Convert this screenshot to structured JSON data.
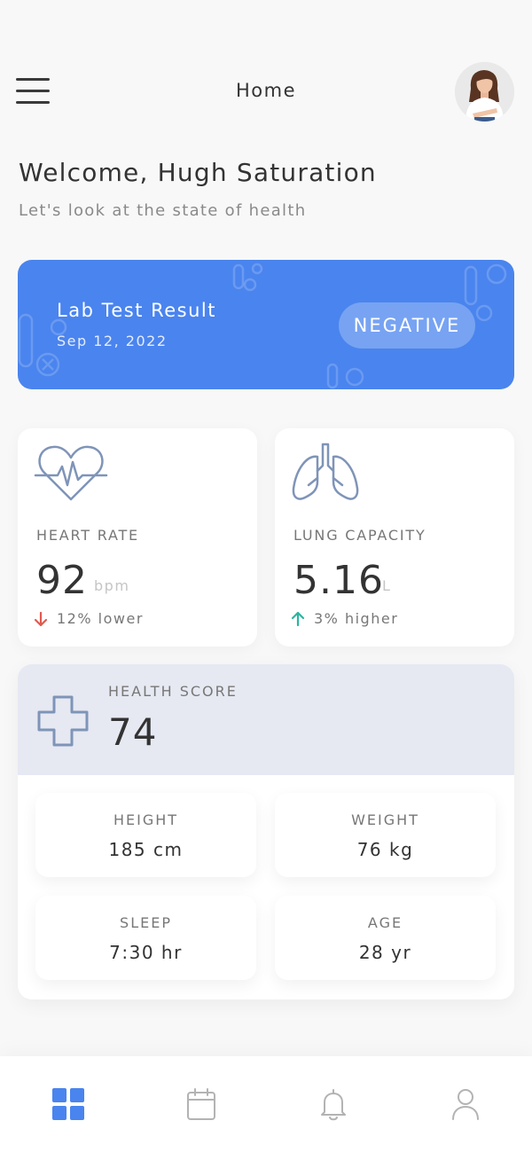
{
  "header": {
    "title": "Home"
  },
  "greeting": {
    "title": "Welcome, Hugh Saturation",
    "subtitle": "Let's look at the state of health"
  },
  "lab": {
    "title": "Lab Test Result",
    "date": "Sep 12, 2022",
    "status": "NEGATIVE"
  },
  "metrics": [
    {
      "label": "HEART RATE",
      "value": "92",
      "unit": "bpm",
      "change": "12% lower",
      "direction": "down",
      "change_color": "#e05a4f",
      "icon": "heart-pulse-icon"
    },
    {
      "label": "LUNG CAPACITY",
      "value": "5.16",
      "unit": "L",
      "change": "3% higher",
      "direction": "up",
      "change_color": "#2bb5a0",
      "icon": "lungs-icon"
    }
  ],
  "health_score": {
    "label": "HEALTH SCORE",
    "value": "74",
    "icon": "medical-cross-icon",
    "stats": [
      {
        "label": "HEIGHT",
        "value": "185 cm"
      },
      {
        "label": "WEIGHT",
        "value": "76 kg"
      },
      {
        "label": "SLEEP",
        "value": "7:30 hr"
      },
      {
        "label": "AGE",
        "value": "28 yr"
      }
    ]
  },
  "nav": {
    "items": [
      "dashboard-icon",
      "calendar-icon",
      "bell-icon",
      "user-icon"
    ],
    "active": "dashboard-icon"
  },
  "colors": {
    "accent": "#4a84ee",
    "icon_line": "#7f94b8",
    "score_bg": "#e6e9f2"
  }
}
